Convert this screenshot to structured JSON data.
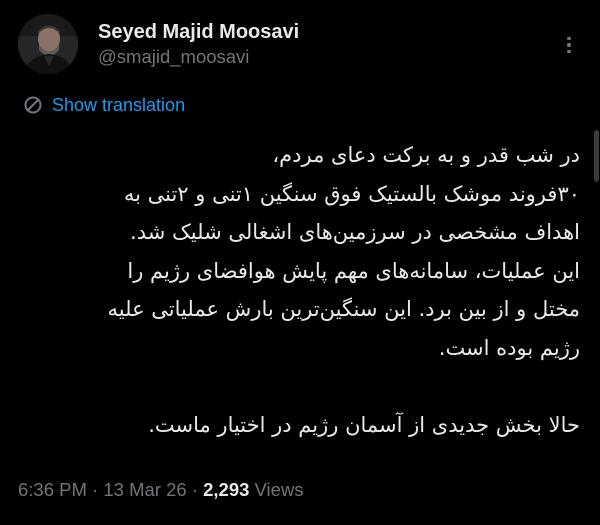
{
  "author": {
    "display_name": "Seyed Majid Moosavi",
    "handle": "@smajid_moosavi",
    "avatar_icon": "profile-photo"
  },
  "more_icon": "more-dots-icon",
  "translation": {
    "icon": "globe-translate-icon",
    "label": "Show translation",
    "color": "#1d9bf0"
  },
  "tweet": {
    "lines": [
      "در شب قدر و به برکت دعای مردم،",
      "۳۰فروند موشک بالستیک فوق سنگین ۱تنی و ۲تنی به",
      "اهداف مشخصی در سرزمین‌های اشغالی شلیک شد.",
      "این عملیات، سامانه‌های مهم پایش هوافضای رژیم را",
      "مختل و از بین برد. این سنگین‌ترین بارش عملیاتی علیه",
      "رژیم بوده است.",
      "حالا بخش جدیدی از آسمان رژیم در اختیار ماست."
    ]
  },
  "meta": {
    "time": "6:36 PM",
    "separator": "·",
    "date": "13 Mar 26",
    "views_count": "2,293",
    "views_label": "Views"
  },
  "colors": {
    "background": "#000000",
    "primary_text": "#e7e9ea",
    "secondary_text": "#71767b",
    "accent": "#1d9bf0"
  }
}
